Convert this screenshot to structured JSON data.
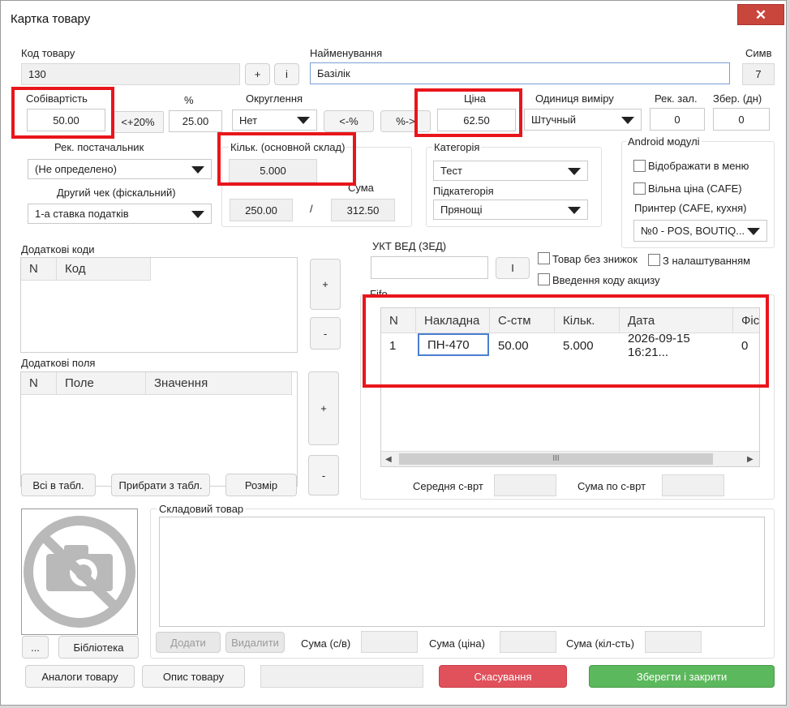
{
  "window": {
    "title": "Картка товару",
    "close_glyph": "✕"
  },
  "fields": {
    "code_label": "Код товару",
    "code_value": "130",
    "plus": "+",
    "info": "i",
    "name_label": "Найменування",
    "name_value": "Базілік",
    "sym_label": "Симв",
    "sym_value": "7",
    "cost_label": "Собівартість",
    "cost_value": "50.00",
    "plus20": "<+20%",
    "pct_label": "%",
    "pct_value": "25.00",
    "round_label": "Округлення",
    "round_value": "Нет",
    "left_pct": "<-%",
    "right_pct": "%->",
    "price_label": "Ціна",
    "price_value": "62.50",
    "unit_label": "Одиниця виміру",
    "unit_value": "Штучный",
    "rec_stock_label": "Рек. зал.",
    "rec_stock_value": "0",
    "storage_label": "Збер. (дн)",
    "storage_value": "0",
    "supplier_label": "Рек. постачальник",
    "supplier_value": "(Не определено)",
    "check_label": "Другий чек (фіскальний)",
    "check_value": "1-а ставка податків",
    "qty_label": "Кільк. (основной склад)",
    "qty_value": "5.000",
    "sum_label": "Сума",
    "sum_a": "250.00",
    "slash": "/",
    "sum_b": "312.50",
    "category_label": "Категорія",
    "category_value": "Тест",
    "subcategory_label": "Підкатегорія",
    "subcategory_value": "Прянощі",
    "android_label": "Android модулі",
    "show_menu": "Відображати в меню",
    "free_price": "Вільна ціна (CAFE)",
    "printer_label": "Принтер (CAFE, кухня)",
    "printer_value": "№0 - POS, BOUTIQ..."
  },
  "codes": {
    "label": "Додаткові коди",
    "headers": [
      "N",
      "Код"
    ],
    "add": "+",
    "remove": "-"
  },
  "extra": {
    "label": "Додаткові поля",
    "headers": [
      "N",
      "Поле",
      "Значення"
    ],
    "add": "+",
    "remove": "-"
  },
  "buttons": {
    "all_to_table": "Всі в табл.",
    "remove_from_table": "Прибрати з табл.",
    "size": "Розмір",
    "dots": "...",
    "library": "Бібліотека",
    "analogs": "Аналоги товару",
    "description": "Опис товару",
    "cancel": "Скасування",
    "save": "Зберегти і закрити",
    "add": "Додати",
    "delete": "Видалити"
  },
  "ukt": {
    "label": "УКТ ВЕД (ЗЕД)",
    "btn": "I"
  },
  "checks": {
    "no_discount": "Товар без знижок",
    "with_settings": "З налаштуванням",
    "excise": "Введення коду акцизу"
  },
  "fifo": {
    "label": "Fifo",
    "headers": [
      "N",
      "Накладна",
      "С-стм",
      "Кільк.",
      "Дата",
      "Фіс"
    ],
    "rows": [
      [
        "1",
        "ПН-470",
        "50.00",
        "5.000",
        "2026-09-15 16:21...",
        "0"
      ]
    ],
    "avg_label": "Середня с-врт",
    "sum_label": "Сума по с-врт",
    "scroll_grip": "III"
  },
  "warehouse": {
    "label": "Складовий товар",
    "sum_cost": "Сума (с/в)",
    "sum_price": "Сума (ціна)",
    "sum_qty": "Сума (кіл-сть)"
  },
  "colors": {
    "highlight": "#e8161b",
    "cancel": "#e0515b",
    "save": "#5cb85c"
  }
}
